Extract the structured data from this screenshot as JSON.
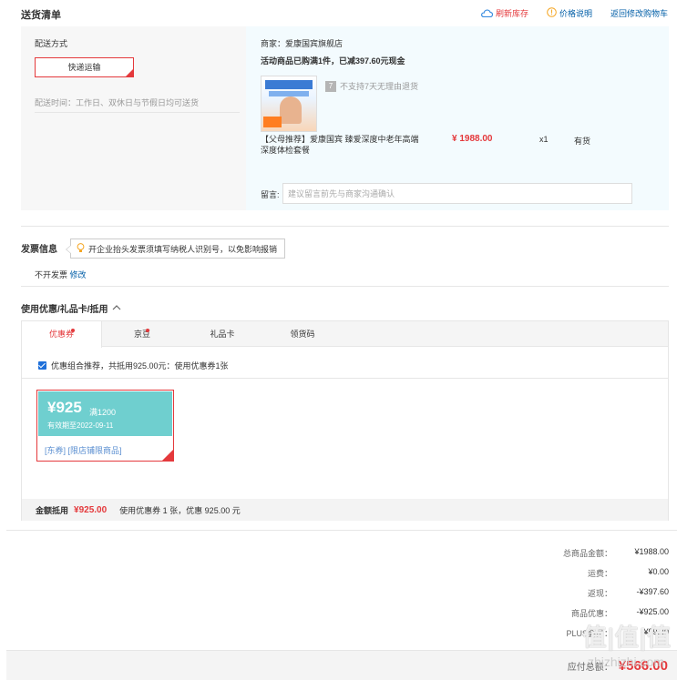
{
  "header": {
    "title": "送货清单",
    "refresh_stock": "刷新库存",
    "price_info": "价格说明",
    "back_to_cart": "返回修改购物车"
  },
  "shipping": {
    "method_label": "配送方式",
    "method_value": "快递运输",
    "time_note": "配送时间：工作日、双休日与节假日均可送货"
  },
  "order": {
    "merchant": "商家：爱康国宾旗舰店",
    "promo": "活动商品已购满1件，已减397.60元现金",
    "no_return": "不支持7天无理由退货",
    "no_return_badge": "7",
    "product_name_1": "【父母推荐】爱康国宾 臻爱深度中老年高端",
    "product_name_2": "深度体检套餐",
    "price": "¥ 1988.00",
    "qty": "x1",
    "stock": "有货",
    "remark_label": "留言:",
    "remark_placeholder": "建议留言前先与商家沟通确认"
  },
  "invoice": {
    "title": "发票信息",
    "tip": "开企业抬头发票须填写纳税人识别号，以免影响报销",
    "value": "不开发票",
    "edit": "修改"
  },
  "coupons": {
    "title": "使用优惠/礼品卡/抵用",
    "tabs": [
      "优惠券",
      "京豆",
      "礼品卡",
      "领货码"
    ],
    "combo_text": "优惠组合推荐，共抵用925.00元：使用优惠券1张",
    "coupon_amount": "¥925",
    "coupon_condition": "满1200",
    "coupon_expiry": "有效期至2022-09-11",
    "coupon_tags": "[东券] [限店铺限商品]",
    "deduct_label": "金额抵用",
    "deduct_value": "¥925.00",
    "deduct_note": "使用优惠券 1 张，优惠 925.00 元"
  },
  "totals": {
    "rows": [
      {
        "label": "总商品金额：",
        "value": "¥1988.00"
      },
      {
        "label": "运费：",
        "value": "¥0.00"
      },
      {
        "label": "返现：",
        "value": "-¥397.60"
      },
      {
        "label": "商品优惠：",
        "value": "-¥925.00"
      },
      {
        "label": "PLUS会员：",
        "value": "-¥99.40"
      }
    ],
    "payable_label": "应付总额：",
    "payable_value": "¥566.00"
  },
  "watermark": {
    "text": "值|值|值",
    "site": "zhizhizhi.com"
  }
}
